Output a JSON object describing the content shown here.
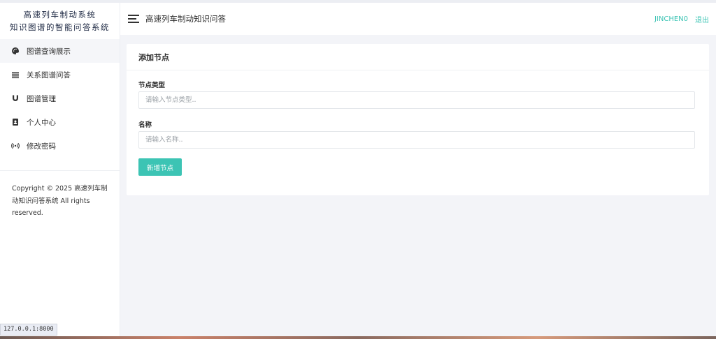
{
  "brand": {
    "line1": "高速列车制动系统",
    "line2": "知识图谱的智能问答系统"
  },
  "sidebar": {
    "items": [
      {
        "label": "图谱查询展示",
        "icon": "palette-icon"
      },
      {
        "label": "关系图谱问答",
        "icon": "list-icon"
      },
      {
        "label": "图谱管理",
        "icon": "magnet-icon"
      },
      {
        "label": "个人中心",
        "icon": "contact-book-icon"
      },
      {
        "label": "修改密码",
        "icon": "broadcast-icon"
      }
    ],
    "copyright": "Copyright © 2025 高速列车制动知识问答系统 All rights reserved."
  },
  "header": {
    "title": "高速列车制动知识问答",
    "user": "JINCHEN0",
    "logout": "退出"
  },
  "card": {
    "title": "添加节点",
    "fields": [
      {
        "label": "节点类型",
        "placeholder": "请输入节点类型.."
      },
      {
        "label": "名称",
        "placeholder": "请输入名称.."
      }
    ],
    "submit_label": "新增节点"
  },
  "status_bar": {
    "url": "127.0.0.1:8000"
  },
  "colors": {
    "accent": "#3cc4b4",
    "background": "#f3f4f8"
  }
}
